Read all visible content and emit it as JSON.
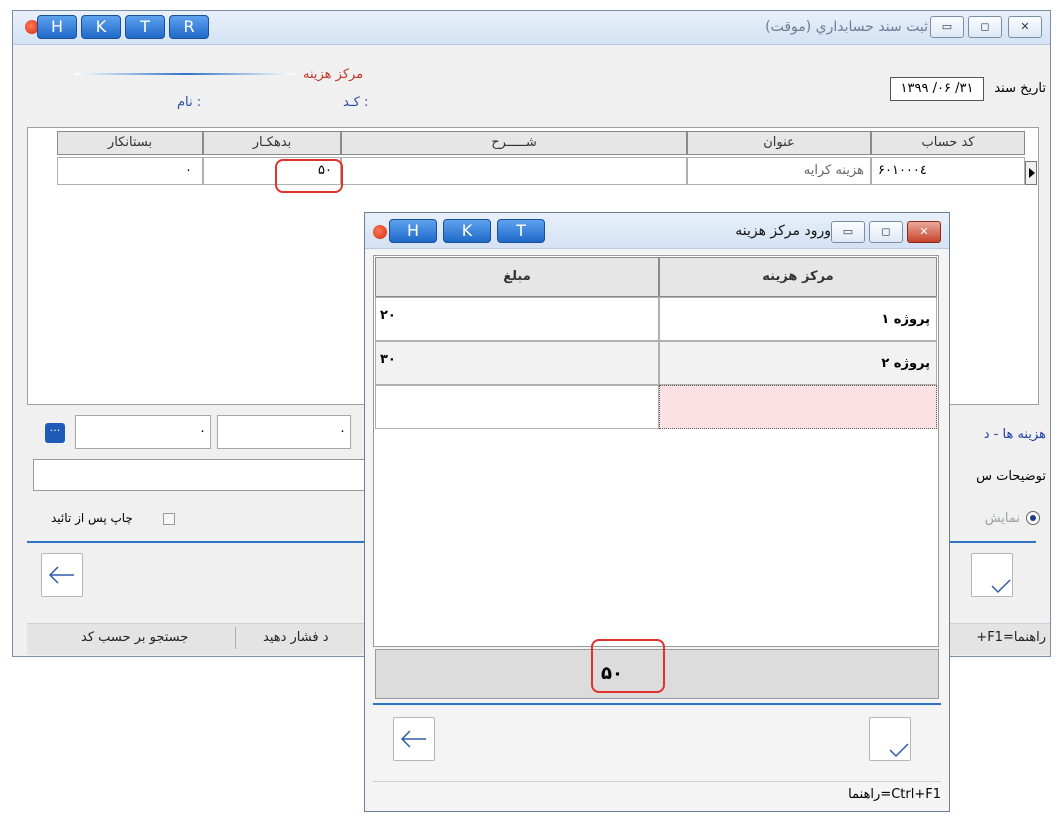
{
  "main_window": {
    "title": "ثبت سند حسابداري (موقت)",
    "hk_buttons": [
      "H",
      "K",
      "T",
      "R"
    ],
    "cost_center_label": "مرکز هزینه",
    "code_label": "کـد :",
    "name_label": "نام :",
    "date_label": "تاريخ سند",
    "date_value": "۱۳۹۹ /۰۶ /۳۱",
    "grid": {
      "headers": {
        "code": "کد حساب",
        "title": "عنوان",
        "desc": "شـــــرح",
        "debit": "بدهکـار",
        "credit": "بستانکار"
      },
      "rows": [
        {
          "code": "۶۰۱۰۰۰٤",
          "title": "هزینه کرایه",
          "desc": "",
          "debit": "۵۰",
          "credit": "۰"
        }
      ]
    },
    "total_field_1": "۰",
    "total_field_2": "۰",
    "cost_link": "هزینه ها - د",
    "desc_label": "توضیحات س",
    "show_label": "نمایش",
    "print_after_confirm": "چاپ پس از تائید",
    "status": {
      "help": "راهنما=F1+",
      "press": "د فشار دهید",
      "search": "جستجو بر حسب کد"
    }
  },
  "dialog": {
    "title": "ورود مرکز هزینه",
    "hk_buttons": [
      "H",
      "K",
      "T"
    ],
    "headers": {
      "center": "مرکز هزینه",
      "amount": "مبلغ"
    },
    "rows": [
      {
        "center": "پروژه ۱",
        "amount": "۲۰"
      },
      {
        "center": "پروژه ۲",
        "amount": "۳۰"
      },
      {
        "center": "",
        "amount": ""
      }
    ],
    "total": "۵۰",
    "help": "راهنما=Ctrl+F1"
  }
}
